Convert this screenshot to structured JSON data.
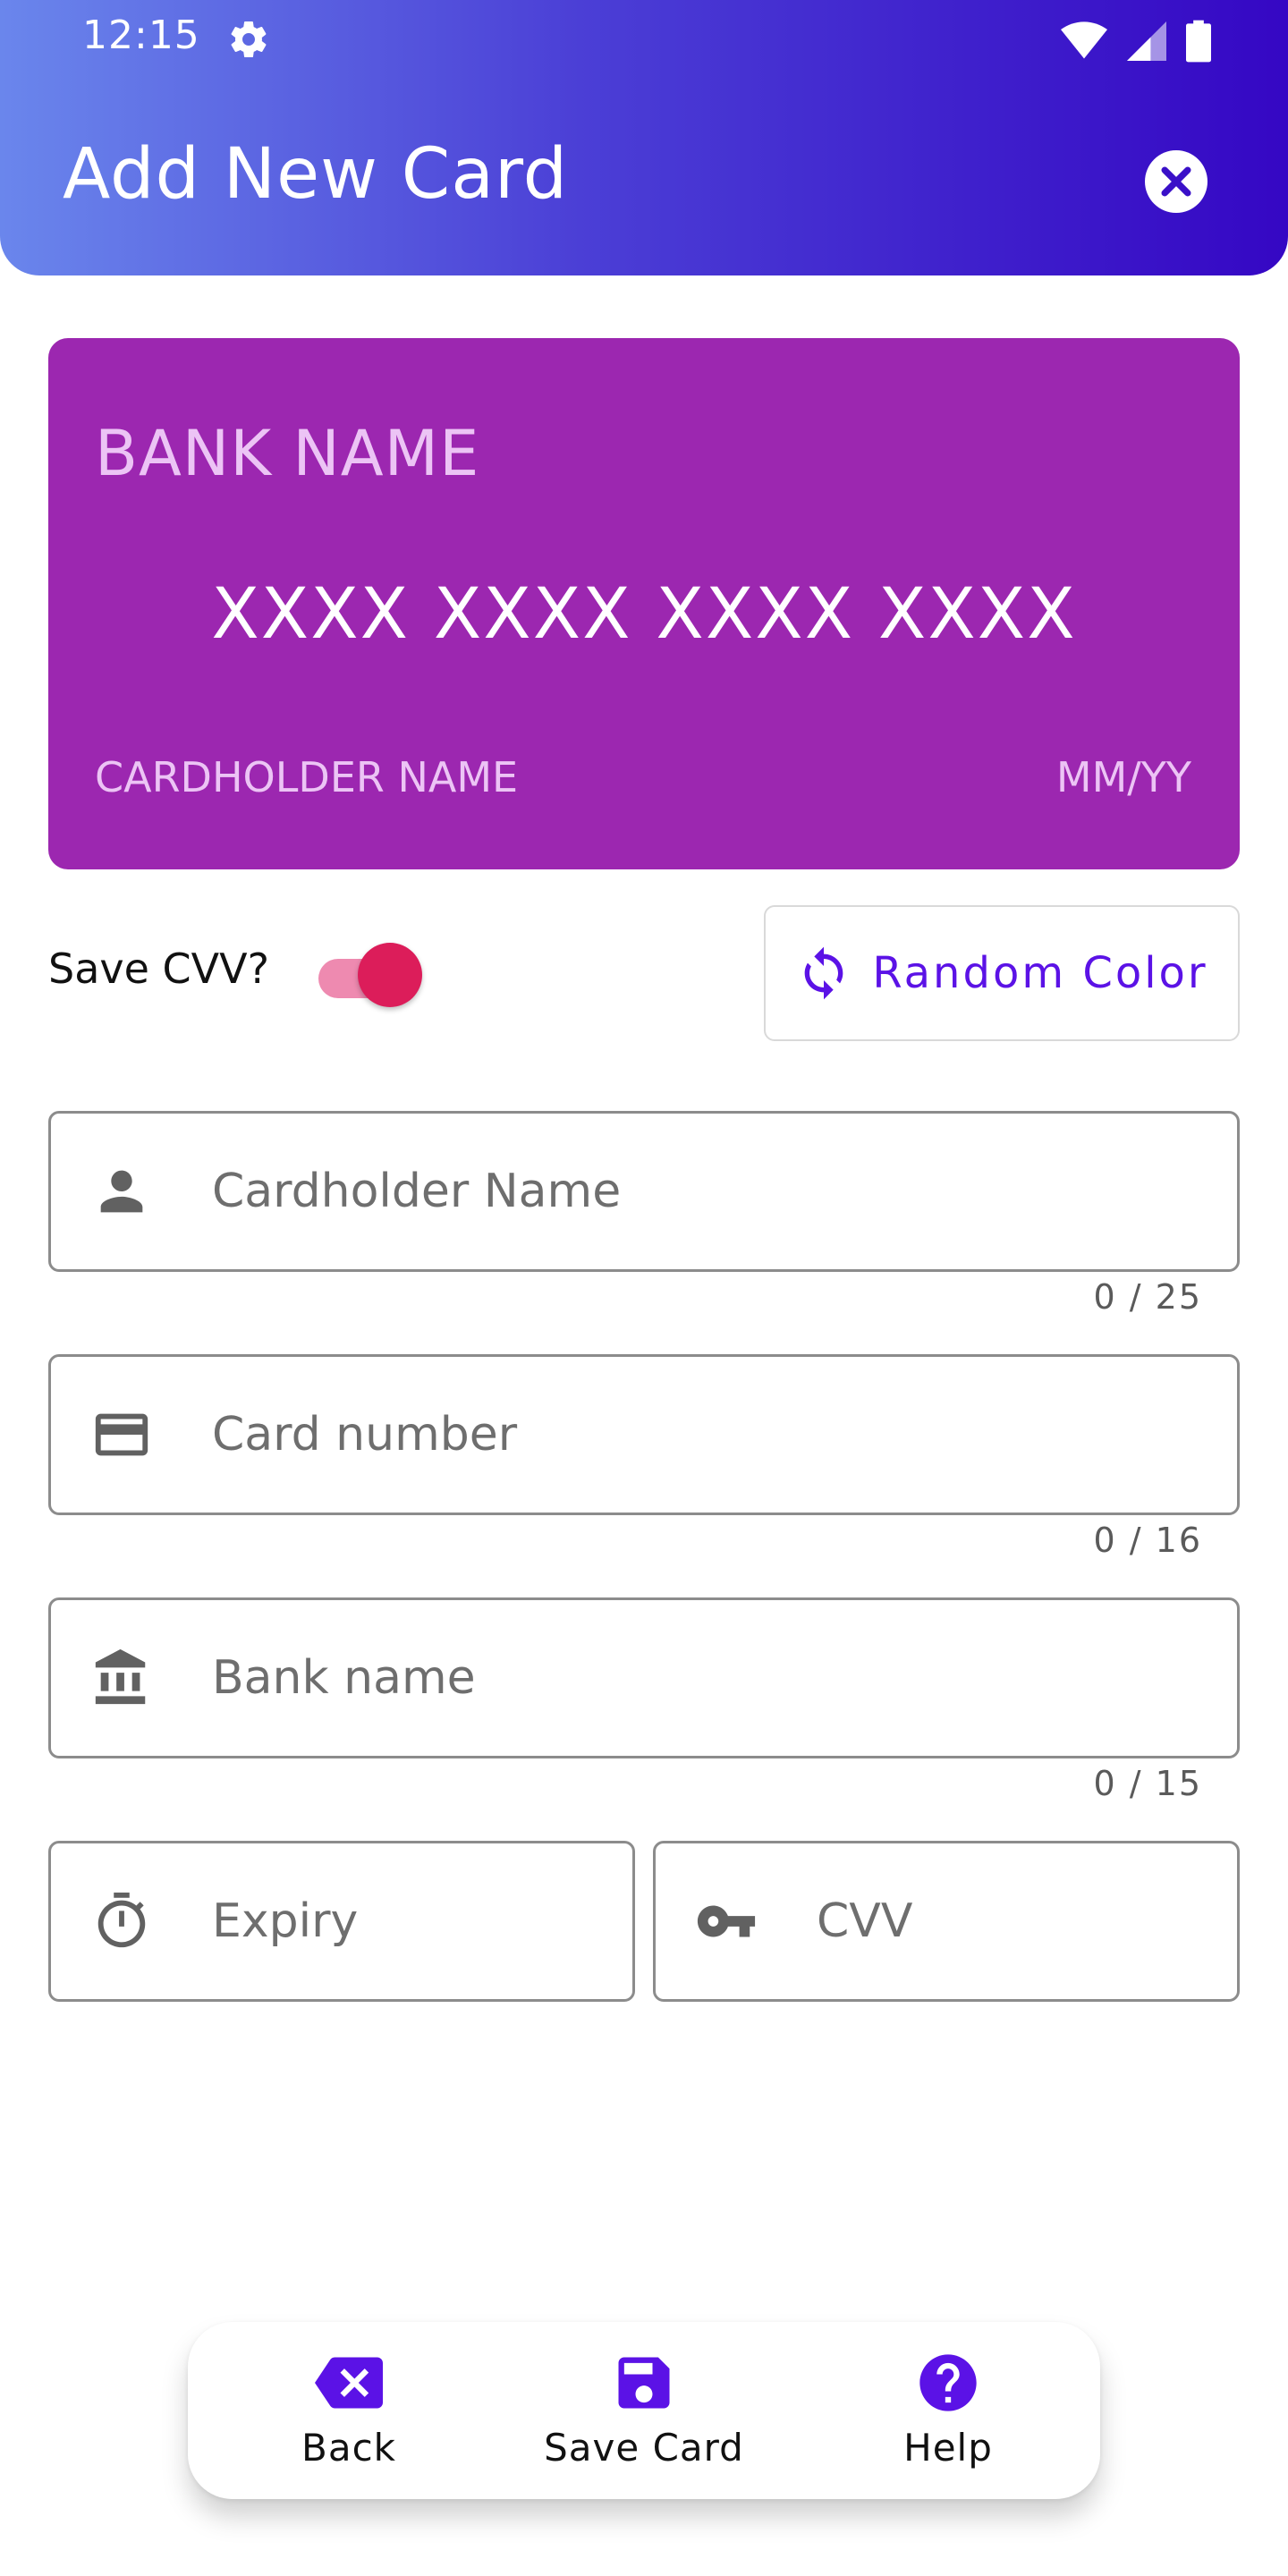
{
  "status_bar": {
    "time": "12:15",
    "icons": [
      "gear-icon",
      "wifi-icon",
      "signal-icon",
      "battery-icon"
    ]
  },
  "header": {
    "title": "Add New Card",
    "close_icon": "close-icon"
  },
  "card_preview": {
    "bank_name": "BANK NAME",
    "card_number": "XXXX XXXX XXXX XXXX",
    "cardholder": "CARDHOLDER NAME",
    "expiry": "MM/YY",
    "color": "#9c27b0"
  },
  "options": {
    "save_cvv_label": "Save CVV?",
    "save_cvv_on": true,
    "random_color_label": "Random Color"
  },
  "form": {
    "cardholder": {
      "placeholder": "Cardholder Name",
      "counter": "0 / 25",
      "icon": "person-icon"
    },
    "card_number": {
      "placeholder": "Card number",
      "counter": "0 / 16",
      "icon": "credit-card-icon"
    },
    "bank_name": {
      "placeholder": "Bank name",
      "counter": "0 / 15",
      "icon": "bank-icon"
    },
    "expiry": {
      "placeholder": "Expiry",
      "icon": "timer-icon"
    },
    "cvv": {
      "placeholder": "CVV",
      "icon": "key-icon"
    }
  },
  "bottom_nav": {
    "back": {
      "label": "Back",
      "icon": "backspace-icon"
    },
    "save": {
      "label": "Save Card",
      "icon": "save-icon"
    },
    "help": {
      "label": "Help",
      "icon": "help-icon"
    }
  },
  "colors": {
    "accent": "#5b12e6",
    "toggle": "#dc1d5a",
    "header_start": "#6a86ec",
    "header_end": "#3507c4"
  }
}
